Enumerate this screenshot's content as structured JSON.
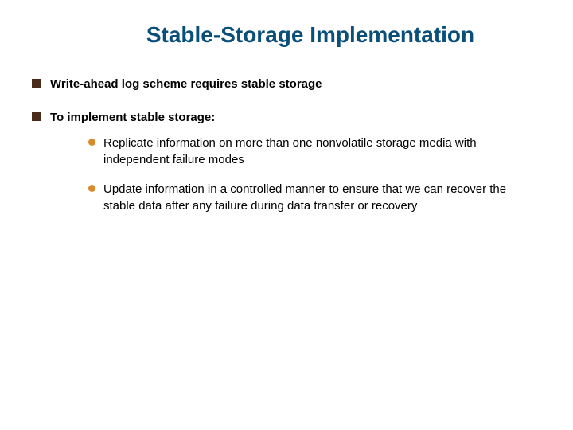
{
  "title": "Stable-Storage Implementation",
  "bullets": {
    "b1": "Write-ahead log scheme requires stable storage",
    "b2": "To implement stable storage:",
    "b2_sub1": "Replicate information on more than one nonvolatile storage media with independent failure modes",
    "b2_sub2": "Update information in a controlled manner to ensure that we can recover the stable data after any failure during data transfer or recovery"
  }
}
